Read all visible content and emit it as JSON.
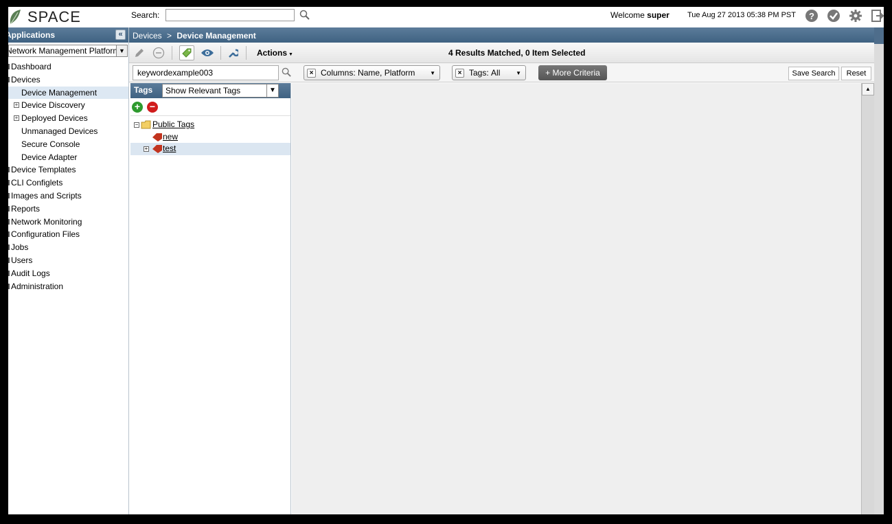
{
  "header": {
    "app_name": "SPACE",
    "search_label": "Search:",
    "search_value": "",
    "welcome_prefix": "Welcome",
    "username": "super",
    "datetime": "Tue Aug 27 2013 05:38 PM PST",
    "icons": [
      "help-icon",
      "check-icon",
      "gear-icon",
      "logout-icon"
    ]
  },
  "sidebar": {
    "title": "Applications",
    "app_select": "Network Management Platform",
    "items": [
      {
        "label": "Dashboard",
        "level": 1
      },
      {
        "label": "Devices",
        "level": 1
      },
      {
        "label": "Device Management",
        "level": 2,
        "active": true
      },
      {
        "label": "Device Discovery",
        "level": 2,
        "expandable": true
      },
      {
        "label": "Deployed Devices",
        "level": 2,
        "expandable": true
      },
      {
        "label": "Unmanaged Devices",
        "level": 2
      },
      {
        "label": "Secure Console",
        "level": 2
      },
      {
        "label": "Device Adapter",
        "level": 2
      },
      {
        "label": "Device Templates",
        "level": 1
      },
      {
        "label": "CLI Configlets",
        "level": 1
      },
      {
        "label": "Images and Scripts",
        "level": 1
      },
      {
        "label": "Reports",
        "level": 1
      },
      {
        "label": "Network Monitoring",
        "level": 1
      },
      {
        "label": "Configuration Files",
        "level": 1
      },
      {
        "label": "Jobs",
        "level": 1
      },
      {
        "label": "Users",
        "level": 1
      },
      {
        "label": "Audit Logs",
        "level": 1
      },
      {
        "label": "Administration",
        "level": 1
      }
    ]
  },
  "breadcrumb": {
    "parent": "Devices",
    "separator": ">",
    "current": "Device Management"
  },
  "toolbar": {
    "actions_label": "Actions",
    "result_text": "4 Results Matched, 0 Item Selected"
  },
  "filters": {
    "keyword": "keywordexample003",
    "columns_label": "Columns:",
    "columns_value": "Name, Platform",
    "tags_label": "Tags:",
    "tags_value": "All",
    "more_criteria": "+ More Criteria",
    "save_search": "Save Search",
    "reset": "Reset"
  },
  "tags_panel": {
    "title": "Tags",
    "select_value": "Show Relevant Tags",
    "tree": {
      "root": "Public Tags",
      "children": [
        "new",
        "test"
      ]
    }
  },
  "colors": {
    "header_blue": "#4a6b8a",
    "selected_row": "#dbe6f1",
    "content_bg": "#efefef"
  }
}
